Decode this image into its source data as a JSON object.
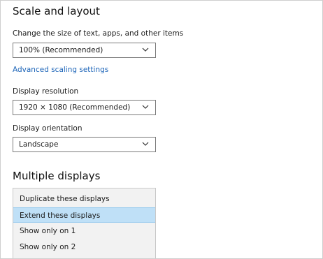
{
  "scale_layout": {
    "title": "Scale and layout",
    "size_label": "Change the size of text, apps, and other items",
    "size_value": "100% (Recommended)",
    "advanced_link": "Advanced scaling settings",
    "resolution_label": "Display resolution",
    "resolution_value": "1920 × 1080 (Recommended)",
    "orientation_label": "Display orientation",
    "orientation_value": "Landscape"
  },
  "multiple_displays": {
    "title": "Multiple displays",
    "options": [
      "Duplicate these displays",
      "Extend these displays",
      "Show only on 1",
      "Show only on 2"
    ],
    "selected": "Extend these displays"
  },
  "colors": {
    "link": "#1c64b8",
    "selected_bg": "#bfe0f7",
    "list_bg": "#f2f2f2"
  },
  "icons": {
    "dropdown": "chevron-down-icon"
  }
}
